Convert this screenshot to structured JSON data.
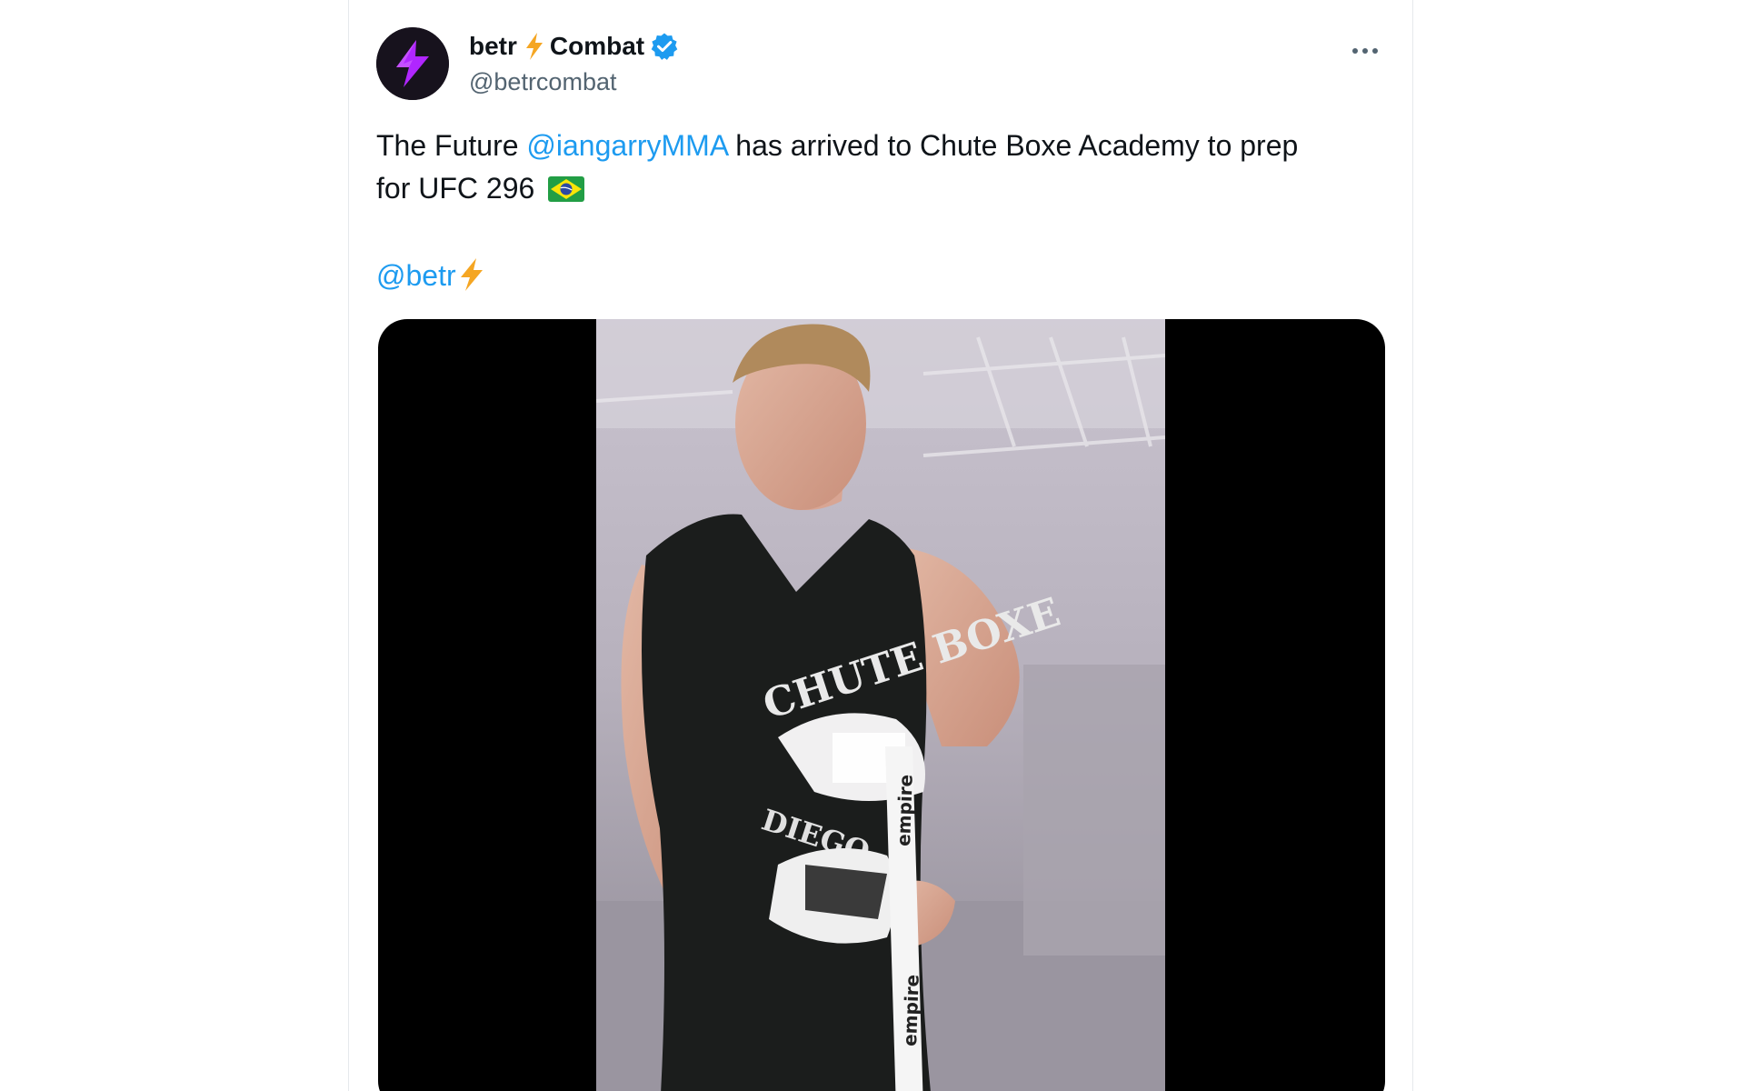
{
  "author": {
    "name_part1": "betr",
    "name_part2": "Combat",
    "handle": "@betrcombat",
    "verified": true,
    "avatar_icon": "betr-lightning-logo-icon"
  },
  "tweet": {
    "text_prefix": "The Future ",
    "mention1": "@iangarryMMA",
    "text_suffix": " has arrived to Chute Boxe Academy to prep",
    "line2": "for UFC 296",
    "flag_icon": "brazil-flag-icon",
    "mention2": "@betr"
  },
  "media": {
    "type": "video",
    "shirt_text": "CHUTE BOXE",
    "shirt_subtext": "DIEGO",
    "wrap_brand": "empire"
  },
  "colors": {
    "link": "#1d9bf0",
    "text": "#0f1419",
    "secondary": "#536471",
    "verified": "#1d9bf0",
    "bolt": "#f5a623",
    "brand_purple": "#a020f0"
  }
}
